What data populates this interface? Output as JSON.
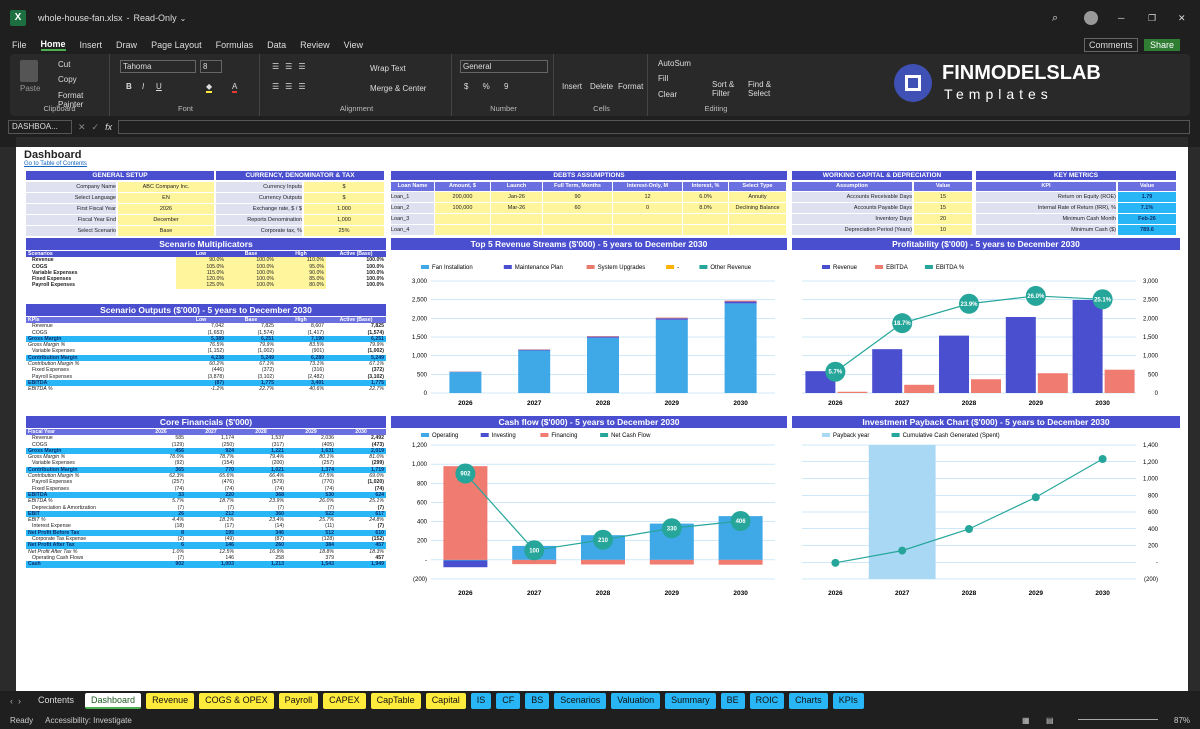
{
  "window": {
    "filename": "whole-house-fan.xlsx",
    "mode": "Read-Only"
  },
  "menu": {
    "items": [
      "File",
      "Home",
      "Insert",
      "Draw",
      "Page Layout",
      "Formulas",
      "Data",
      "Review",
      "View"
    ],
    "comments": "Comments",
    "share": "Share"
  },
  "ribbon": {
    "paste": "Paste",
    "cut": "Cut",
    "copy": "Copy",
    "format_painter": "Format Painter",
    "clipboard": "Clipboard",
    "font_name": "Tahoma",
    "font_size": "8",
    "font": "Font",
    "wrap": "Wrap Text",
    "merge": "Merge & Center",
    "alignment": "Alignment",
    "number_format": "General",
    "number": "Number",
    "insert": "Insert",
    "delete": "Delete",
    "format": "Format",
    "cells": "Cells",
    "autosum": "AutoSum",
    "fill": "Fill",
    "clear": "Clear",
    "sort": "Sort & Filter",
    "find": "Find & Select",
    "editing": "Editing",
    "logo1": "FINMODELSLAB",
    "logo2": "Templates"
  },
  "formula": {
    "namebox": "DASHBOA...",
    "fx": "fx"
  },
  "sheet": {
    "title": "Dashboard",
    "toc": "Go to Table of Contents",
    "general": {
      "header": "GENERAL SETUP",
      "rows": [
        [
          "Company Name",
          "ABC Company Inc."
        ],
        [
          "Select Language",
          "EN"
        ],
        [
          "First Fiscal Year",
          "2026"
        ],
        [
          "Fiscal Year End",
          "December"
        ],
        [
          "Select Scenario",
          "Base"
        ]
      ]
    },
    "currency": {
      "header": "CURRENCY, DENOMINATOR & TAX",
      "rows": [
        [
          "Currency Inputs",
          "$"
        ],
        [
          "Currency Outputs",
          "$"
        ],
        [
          "Exchange rate, $ / $",
          "1.000"
        ],
        [
          "Reports Denomination",
          "1,000"
        ],
        [
          "Corporate tax, %",
          "25%"
        ]
      ]
    },
    "debts": {
      "header": "DEBTS ASSUMPTIONS",
      "cols": [
        "Loan Name",
        "Amount, $",
        "Launch",
        "Full Term, Months",
        "Interest-Only, M",
        "Interest, %",
        "Select Type"
      ],
      "rows": [
        [
          "Loan_1",
          "200,000",
          "Jan-26",
          "90",
          "12",
          "6.0%",
          "Annuity"
        ],
        [
          "Loan_2",
          "100,000",
          "Mar-26",
          "60",
          "0",
          "8.0%",
          "Declining Balance"
        ],
        [
          "Loan_3",
          "",
          "",
          "",
          "",
          "",
          ""
        ],
        [
          "Loan_4",
          "",
          "",
          "",
          "",
          "",
          ""
        ]
      ]
    },
    "wc": {
      "header": "WORKING CAPITAL & DEPRECIATION",
      "cols": [
        "Assumption",
        "Value"
      ],
      "rows": [
        [
          "Accounts Receivable Days",
          "15"
        ],
        [
          "Accounts Payable Days",
          "15"
        ],
        [
          "Inventory Days",
          "20"
        ],
        [
          "Depreciation Period (Years)",
          "10"
        ]
      ]
    },
    "kpi": {
      "header": "KEY METRICS",
      "cols": [
        "KPI",
        "Value"
      ],
      "rows": [
        [
          "Return on Equity (ROE)",
          "1.79"
        ],
        [
          "Internal Rate of Return (IRR), %",
          "7.1%"
        ],
        [
          "Minimum Cash Month",
          "Feb-26"
        ],
        [
          "Minimum Cash ($)",
          "789.6"
        ]
      ]
    },
    "multipliers": {
      "header": "Scenario Multiplicators",
      "cols": [
        "Scenarios",
        "Low",
        "Base",
        "High",
        "Active (Base)"
      ],
      "rows": [
        [
          "Revenue",
          "90.0%",
          "100.0%",
          "110.0%",
          "100.0%"
        ],
        [
          "COGS",
          "105.0%",
          "100.0%",
          "95.0%",
          "100.0%"
        ],
        [
          "Variable Expenses",
          "115.0%",
          "100.0%",
          "90.0%",
          "100.0%"
        ],
        [
          "Fixed Expenses",
          "120.0%",
          "100.0%",
          "85.0%",
          "100.0%"
        ],
        [
          "Payroll Expenses",
          "125.0%",
          "100.0%",
          "80.0%",
          "100.0%"
        ]
      ]
    },
    "outputs": {
      "header": "Scenario Outputs ($'000) - 5 years to December 2030",
      "cols": [
        "KPIs",
        "Low",
        "Base",
        "High",
        "Active (Base)"
      ],
      "rows": [
        [
          "Revenue",
          "7,042",
          "7,825",
          "8,607",
          "7,825",
          ""
        ],
        [
          "COGS",
          "(1,653)",
          "(1,574)",
          "(1,417)",
          "(1,574)",
          ""
        ],
        [
          "Gross Margin",
          "5,389",
          "6,251",
          "7,190",
          "6,251",
          "hl"
        ],
        [
          "Gross Margin %",
          "76.5%",
          "79.9%",
          "83.5%",
          "79.9%",
          "it"
        ],
        [
          "Variable Expenses",
          "(1,152)",
          "(1,002)",
          "(901)",
          "(1,002)",
          ""
        ],
        [
          "Contribution Margin",
          "4,238",
          "5,249",
          "6,289",
          "5,249",
          "hl"
        ],
        [
          "Contribution Margin %",
          "60.2%",
          "67.1%",
          "73.1%",
          "67.1%",
          "it"
        ],
        [
          "Fixed Expenses",
          "(446)",
          "(372)",
          "(316)",
          "(372)",
          ""
        ],
        [
          "Payroll Expenses",
          "(3,878)",
          "(3,102)",
          "(2,482)",
          "(3,102)",
          ""
        ],
        [
          "EBITDA",
          "(87)",
          "1,775",
          "3,491",
          "1,775",
          "hl"
        ],
        [
          "EBITDA %",
          "-1.2%",
          "22.7%",
          "40.6%",
          "22.7%",
          "it"
        ]
      ]
    },
    "core": {
      "header": "Core Financials ($'000)",
      "cols": [
        "Fiscal Year",
        "2026",
        "2027",
        "2028",
        "2029",
        "2030"
      ],
      "rows": [
        [
          "Revenue",
          "585",
          "1,174",
          "1,537",
          "2,036",
          "2,492",
          ""
        ],
        [
          "COGS",
          "(129)",
          "(250)",
          "(317)",
          "(405)",
          "(473)",
          ""
        ],
        [
          "Gross Margin",
          "456",
          "924",
          "1,221",
          "1,631",
          "2,019",
          "hl"
        ],
        [
          "Gross Margin %",
          "78.0%",
          "78.7%",
          "79.4%",
          "80.1%",
          "81.0%",
          "it"
        ],
        [
          "Variable Expenses",
          "(92)",
          "(154)",
          "(200)",
          "(257)",
          "(299)",
          ""
        ],
        [
          "Contribution Margin",
          "365",
          "770",
          "1,021",
          "1,374",
          "1,719",
          "hl"
        ],
        [
          "Contribution Margin %",
          "62.3%",
          "65.6%",
          "66.4%",
          "67.5%",
          "69.0%",
          "it"
        ],
        [
          "Payroll Expenses",
          "(257)",
          "(476)",
          "(579)",
          "(770)",
          "(1,020)",
          ""
        ],
        [
          "Fixed Expenses",
          "(74)",
          "(74)",
          "(74)",
          "(74)",
          "(74)",
          ""
        ],
        [
          "EBITDA",
          "33",
          "220",
          "368",
          "530",
          "624",
          "hl"
        ],
        [
          "EBITDA %",
          "5.7%",
          "18.7%",
          "23.9%",
          "26.0%",
          "25.1%",
          "it"
        ],
        [
          "Depreciation & Amortization",
          "(7)",
          "(7)",
          "(7)",
          "(7)",
          "(7)",
          ""
        ],
        [
          "EBIT",
          "26",
          "212",
          "360",
          "522",
          "617",
          "hl"
        ],
        [
          "EBIT %",
          "4.4%",
          "18.1%",
          "23.4%",
          "25.7%",
          "24.8%",
          "it"
        ],
        [
          "Interest Expense",
          "(18)",
          "(17)",
          "(14)",
          "(11)",
          "(7)",
          ""
        ],
        [
          "Net Profit Before Tax",
          "8",
          "195",
          "346",
          "512",
          "610",
          "hl"
        ],
        [
          "Corporate Tax Expense",
          "(2)",
          "(49)",
          "(87)",
          "(128)",
          "(152)",
          ""
        ],
        [
          "Net Profit After Tax",
          "6",
          "146",
          "260",
          "384",
          "457",
          "hl"
        ],
        [
          "Net Profit After Tax %",
          "1.0%",
          "12.5%",
          "16.9%",
          "18.8%",
          "18.3%",
          "it"
        ],
        [
          "Operating Cash Flows",
          "(7)",
          "146",
          "258",
          "379",
          "457",
          ""
        ],
        [
          "Cash",
          "902",
          "1,003",
          "1,213",
          "1,543",
          "1,949",
          "hl"
        ]
      ]
    }
  },
  "chart_data": [
    {
      "type": "bar",
      "title": "Top 5 Revenue Streams ($'000) - 5 years to December 2030",
      "categories": [
        "2026",
        "2027",
        "2028",
        "2029",
        "2030"
      ],
      "series": [
        {
          "name": "Fan Installation",
          "values": [
            560,
            1140,
            1480,
            1960,
            2400
          ],
          "color": "#3fa9e8"
        },
        {
          "name": "Maintenance Plan",
          "values": [
            10,
            20,
            30,
            40,
            50
          ],
          "color": "#4a4fcf"
        },
        {
          "name": "System Upgrades",
          "values": [
            5,
            10,
            15,
            20,
            25
          ],
          "color": "#e87b6b"
        },
        {
          "name": "-",
          "values": [
            0,
            0,
            0,
            0,
            0
          ],
          "color": "#ffb300"
        },
        {
          "name": "Other Revenue",
          "values": [
            0,
            0,
            0,
            0,
            0
          ],
          "color": "#26a69a"
        }
      ],
      "yticks": [
        "0",
        "500",
        "1,000",
        "1,500",
        "2,000",
        "2,500",
        "3,000"
      ],
      "ylim": [
        0,
        3000
      ]
    },
    {
      "type": "bar",
      "title": "Profitability ($'000) - 5 years to December 2030",
      "categories": [
        "2026",
        "2027",
        "2028",
        "2029",
        "2030"
      ],
      "series": [
        {
          "name": "Revenue",
          "values": [
            585,
            1174,
            1537,
            2036,
            2492
          ],
          "color": "#4a4fcf"
        },
        {
          "name": "EBITDA",
          "values": [
            33,
            220,
            368,
            530,
            624
          ],
          "color": "#f07b70"
        },
        {
          "name": "EBITDA %",
          "values": [
            5.7,
            18.7,
            23.9,
            26.0,
            25.1
          ],
          "labels": [
            "5.7%",
            "18.7%",
            "23.9%",
            "26.0%",
            "25.1%"
          ],
          "color": "#26a69a"
        }
      ],
      "yticks": [
        "0",
        "500",
        "1,000",
        "1,500",
        "2,000",
        "2,500",
        "3,000"
      ],
      "ylim": [
        0,
        3000
      ]
    },
    {
      "type": "bar",
      "title": "Cash flow ($'000) - 5 years to December 2030",
      "categories": [
        "2026",
        "2027",
        "2028",
        "2029",
        "2030"
      ],
      "series": [
        {
          "name": "Operating",
          "values": [
            -7,
            146,
            258,
            379,
            457
          ],
          "color": "#3fa9e8"
        },
        {
          "name": "Investing",
          "values": [
            -70,
            0,
            0,
            0,
            0
          ],
          "color": "#4a4fcf"
        },
        {
          "name": "Financing",
          "values": [
            979,
            -45,
            -48,
            -49,
            -51
          ],
          "color": "#f07b70"
        },
        {
          "name": "Net Cash Flow",
          "values": [
            902,
            100,
            210,
            330,
            406
          ],
          "labels": [
            "902",
            "100",
            "210",
            "330",
            "406"
          ],
          "color": "#26a69a"
        }
      ],
      "yticks": [
        "(200)",
        "-",
        "200",
        "400",
        "600",
        "800",
        "1,000",
        "1,200"
      ],
      "ylim": [
        -200,
        1200
      ]
    },
    {
      "type": "line",
      "title": "Investment Payback Chart ($'000) - 5 years to December 2030",
      "categories": [
        "2026",
        "2027",
        "2028",
        "2029",
        "2030"
      ],
      "series": [
        {
          "name": "Payback year",
          "values": [
            0,
            1,
            0,
            0,
            0
          ],
          "color": "#a9d8f5"
        },
        {
          "name": "Cumulative Cash Generated (Spent)",
          "values": [
            -7,
            139,
            397,
            776,
            1233
          ],
          "color": "#26a69a"
        }
      ],
      "yticks": [
        "(200)",
        "-",
        "200",
        "400",
        "600",
        "800",
        "1,000",
        "1,200",
        "1,400"
      ],
      "ylim": [
        -200,
        1400
      ]
    }
  ],
  "tabs": [
    {
      "label": "Contents",
      "style": "plain"
    },
    {
      "label": "Dashboard",
      "style": "active"
    },
    {
      "label": "Revenue",
      "style": "yellow"
    },
    {
      "label": "COGS & OPEX",
      "style": "yellow"
    },
    {
      "label": "Payroll",
      "style": "yellow"
    },
    {
      "label": "CAPEX",
      "style": "yellow"
    },
    {
      "label": "CapTable",
      "style": "yellow"
    },
    {
      "label": "Capital",
      "style": "yellow"
    },
    {
      "label": "IS",
      "style": "blue"
    },
    {
      "label": "CF",
      "style": "blue"
    },
    {
      "label": "BS",
      "style": "blue"
    },
    {
      "label": "Scenarios",
      "style": "blue"
    },
    {
      "label": "Valuation",
      "style": "blue"
    },
    {
      "label": "Summary",
      "style": "blue"
    },
    {
      "label": "BE",
      "style": "blue"
    },
    {
      "label": "ROIC",
      "style": "blue"
    },
    {
      "label": "Charts",
      "style": "blue"
    },
    {
      "label": "KPIs",
      "style": "blue"
    }
  ],
  "status": {
    "ready": "Ready",
    "accessibility": "Accessibility: Investigate",
    "zoom": "87%"
  }
}
